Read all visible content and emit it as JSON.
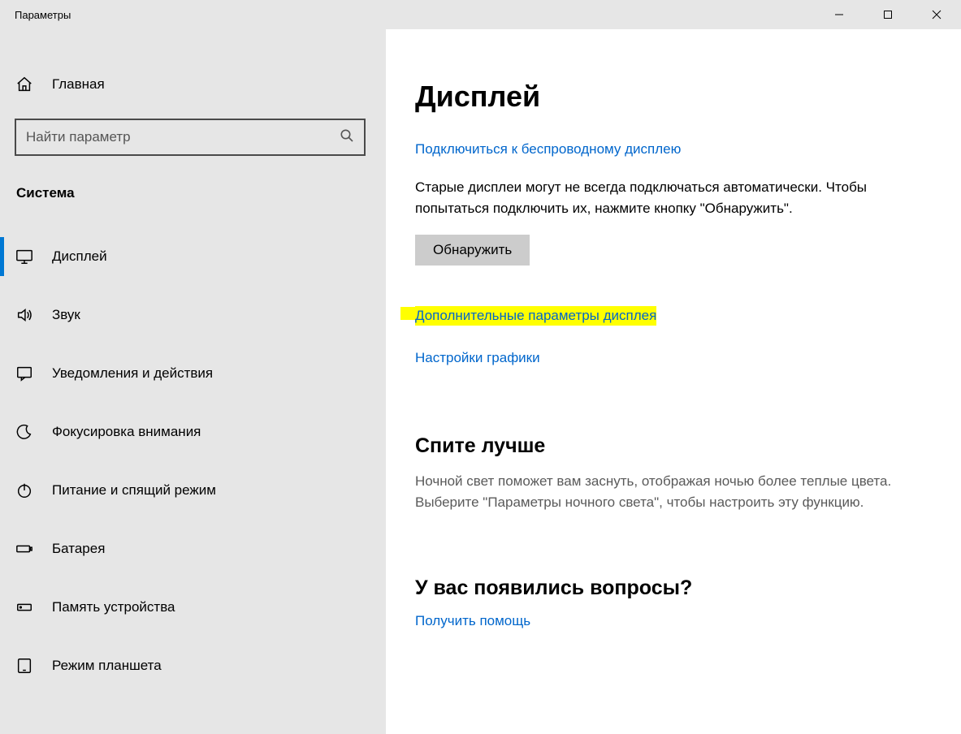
{
  "window": {
    "title": "Параметры"
  },
  "sidebar": {
    "home": "Главная",
    "search_placeholder": "Найти параметр",
    "section": "Система",
    "items": [
      {
        "label": "Дисплей",
        "icon": "display",
        "active": true
      },
      {
        "label": "Звук",
        "icon": "sound",
        "active": false
      },
      {
        "label": "Уведомления и действия",
        "icon": "notifications",
        "active": false
      },
      {
        "label": "Фокусировка внимания",
        "icon": "focus",
        "active": false
      },
      {
        "label": "Питание и спящий режим",
        "icon": "power",
        "active": false
      },
      {
        "label": "Батарея",
        "icon": "battery",
        "active": false
      },
      {
        "label": "Память устройства",
        "icon": "storage",
        "active": false
      },
      {
        "label": "Режим планшета",
        "icon": "tablet",
        "active": false
      }
    ]
  },
  "content": {
    "title": "Дисплей",
    "wireless_link": "Подключиться к беспроводному дисплею",
    "old_displays_text": "Старые дисплеи могут не всегда подключаться автоматически. Чтобы попытаться подключить их, нажмите кнопку \"Обнаружить\".",
    "detect_button": "Обнаружить",
    "advanced_link": "Дополнительные параметры дисплея",
    "graphics_link": "Настройки графики",
    "sleep_heading": "Спите лучше",
    "sleep_text": "Ночной свет поможет вам заснуть, отображая ночью более теплые цвета. Выберите \"Параметры ночного света\", чтобы настроить эту функцию.",
    "help_heading": "У вас появились вопросы?",
    "help_link": "Получить помощь"
  }
}
